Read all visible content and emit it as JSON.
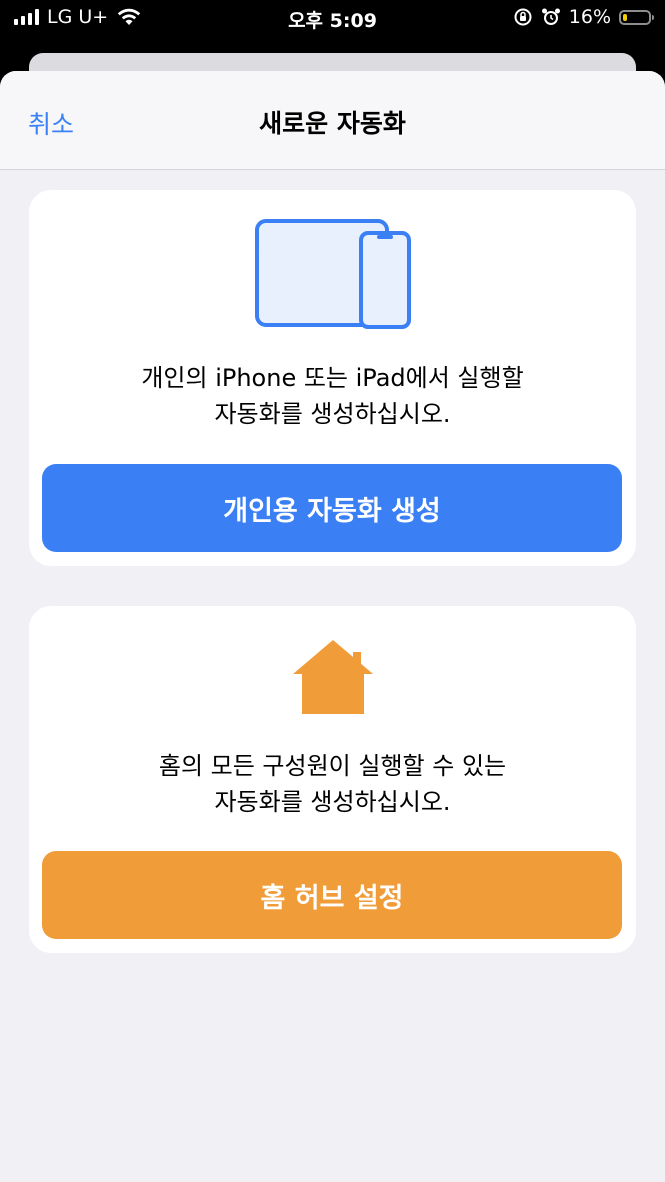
{
  "status_bar": {
    "carrier": "LG U+",
    "time": "오후 5:09",
    "battery_percent": "16%",
    "battery_level": 0.16,
    "battery_color": "#f5d000",
    "icons": [
      "signal-icon",
      "wifi-icon",
      "orientation-lock-icon",
      "alarm-icon",
      "battery-icon"
    ]
  },
  "nav": {
    "cancel_label": "취소",
    "title": "새로운 자동화"
  },
  "personal_card": {
    "icon": "ipad-iphone-icon",
    "description": "개인의 iPhone 또는 iPad에서 실행할\n자동화를 생성하십시오.",
    "button_label": "개인용 자동화 생성",
    "button_color": "#3b7ff5"
  },
  "home_card": {
    "icon": "home-icon",
    "description": "홈의 모든 구성원이 실행할 수 있는\n자동화를 생성하십시오.",
    "button_label": "홈 허브 설정",
    "button_color": "#f09c38"
  },
  "colors": {
    "accent": "#3a82f7",
    "background": "#f0f0f5",
    "card": "#ffffff"
  }
}
